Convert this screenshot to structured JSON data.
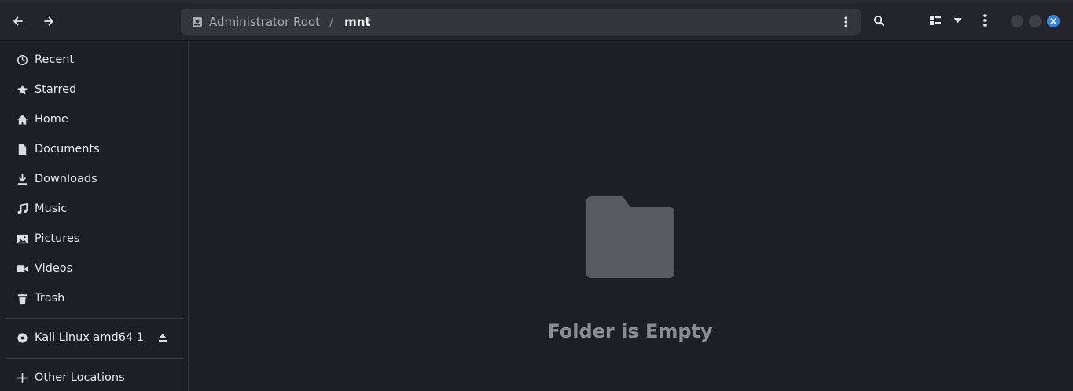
{
  "header": {
    "back_icon": "arrow-left-icon",
    "forward_icon": "arrow-right-icon",
    "path": {
      "root_label": "Administrator Root",
      "separator": "/",
      "current": "mnt"
    },
    "search_icon": "search-icon",
    "view_icon": "list-view-icon",
    "view_dropdown_icon": "chevron-down-icon",
    "menu_icon": "kebab-menu-icon",
    "colors": {
      "close": "#3584e4"
    }
  },
  "sidebar": {
    "places": [
      {
        "label": "Recent",
        "icon": "clock-icon"
      },
      {
        "label": "Starred",
        "icon": "star-icon"
      },
      {
        "label": "Home",
        "icon": "home-icon"
      },
      {
        "label": "Documents",
        "icon": "document-icon"
      },
      {
        "label": "Downloads",
        "icon": "download-icon"
      },
      {
        "label": "Music",
        "icon": "music-icon"
      },
      {
        "label": "Pictures",
        "icon": "picture-icon"
      },
      {
        "label": "Videos",
        "icon": "video-icon"
      },
      {
        "label": "Trash",
        "icon": "trash-icon"
      }
    ],
    "devices": [
      {
        "label": "Kali Linux amd64 1",
        "icon": "disc-icon",
        "eject_icon": "eject-icon"
      }
    ],
    "other": {
      "label": "Other Locations",
      "icon": "plus-icon"
    }
  },
  "content": {
    "empty_icon": "folder-icon",
    "empty_message": "Folder is Empty"
  }
}
